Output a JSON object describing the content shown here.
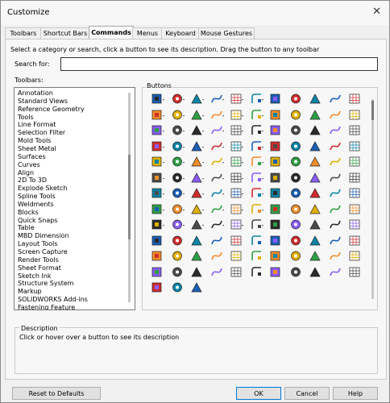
{
  "window": {
    "title": "Customize",
    "close_icon": "close-icon"
  },
  "tabs": [
    "Toolbars",
    "Shortcut Bars",
    "Commands",
    "Menus",
    "Keyboard",
    "Mouse Gestures"
  ],
  "active_tab": "Commands",
  "instructions": "Select a category or search, click a button to see its description. Drag the button to any toolbar",
  "search": {
    "label": "Search for:",
    "value": ""
  },
  "toolbars": {
    "label": "Toolbars:",
    "items": [
      "Annotation",
      "Standard Views",
      "Reference Geometry",
      "Tools",
      "Line Format",
      "Selection Filter",
      "Mold Tools",
      "Sheet Metal",
      "Surfaces",
      "Curves",
      "Align",
      "2D To 3D",
      "Explode Sketch",
      "Spline Tools",
      "Weldments",
      "Blocks",
      "Quick Snaps",
      "Table",
      "MBD Dimension",
      "Layout Tools",
      "Screen Capture",
      "Render Tools",
      "Sheet Format",
      "Sketch Ink",
      "Structure System",
      "Markup",
      "SOLIDWORKS Add-ins",
      "Fastening Feature"
    ]
  },
  "buttons": {
    "label": "Buttons",
    "icon_count": 135,
    "palette": [
      "#1a5fb4",
      "#e0b000",
      "#2a2a2a",
      "#d12c2c",
      "#2ea043",
      "#8b5cf6",
      "#0b84a5",
      "#f28c28",
      "#4a4a4a"
    ]
  },
  "description": {
    "label": "Description",
    "text": "Click or hover over a button to see its description"
  },
  "footer": {
    "reset": "Reset to Defaults",
    "ok": "OK",
    "cancel": "Cancel",
    "help": "Help"
  }
}
